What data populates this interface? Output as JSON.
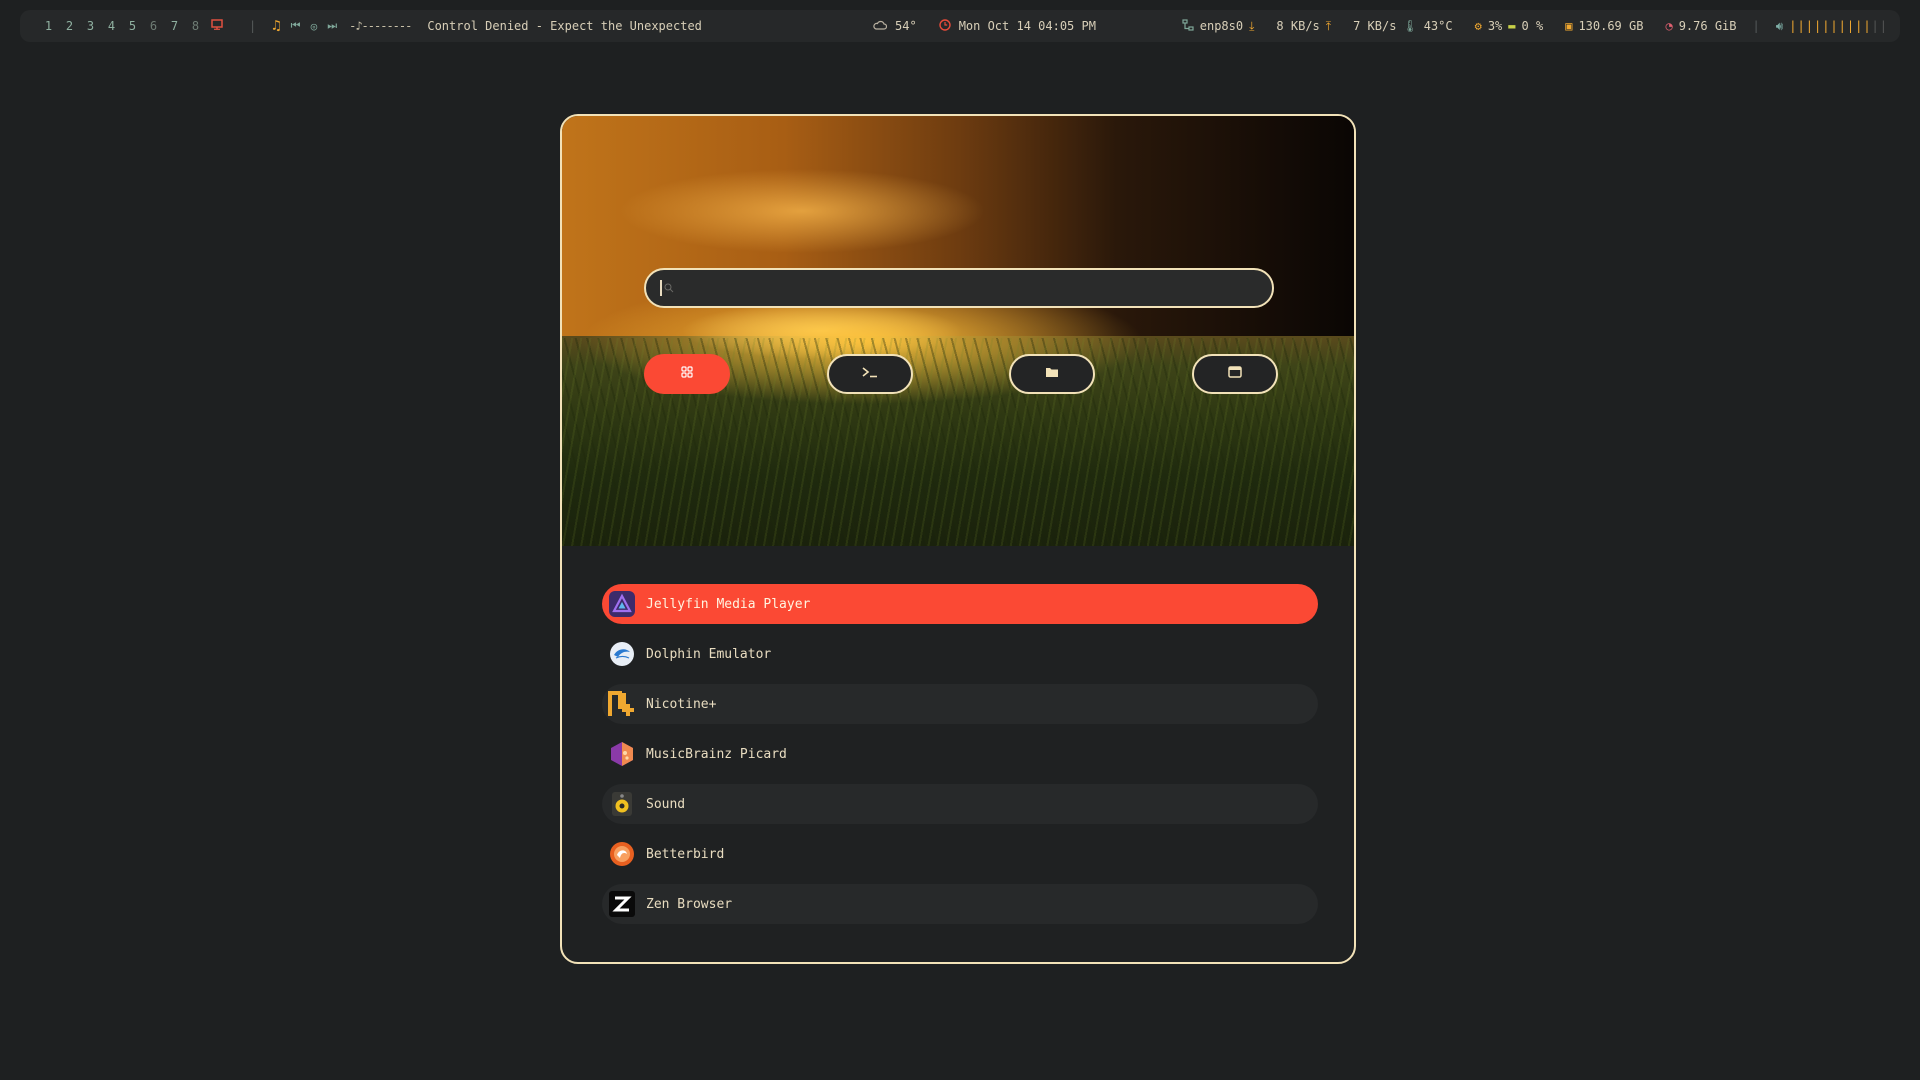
{
  "bar": {
    "workspaces": [
      "1",
      "2",
      "3",
      "4",
      "5",
      "6",
      "7",
      "8"
    ],
    "media": {
      "progress": "-♪--------",
      "song": "Control Denied - Expect the Unexpected"
    },
    "weather": "54°",
    "datetime": "Mon Oct 14 04:05 PM",
    "net_iface": "enp8s0",
    "download": "8 KB/s",
    "upload": "7 KB/s",
    "temp": "43°C",
    "cpu": "3%",
    "battery": "0 %",
    "disk": "130.69 GB",
    "mem": "9.76 GiB",
    "volume_bars": "||||||||||",
    "volume_off": "||"
  },
  "launcher": {
    "search": {
      "value": "",
      "placeholder": ""
    },
    "modes": [
      {
        "icon": "grid-icon",
        "active": true
      },
      {
        "icon": "terminal-icon",
        "active": false
      },
      {
        "icon": "folder-icon",
        "active": false
      },
      {
        "icon": "window-icon",
        "active": false
      }
    ],
    "apps": [
      {
        "name": "Jellyfin Media Player",
        "icon": "jellyfin-icon"
      },
      {
        "name": "Dolphin Emulator",
        "icon": "dolphin-icon"
      },
      {
        "name": "Nicotine+",
        "icon": "nicotine-icon"
      },
      {
        "name": "MusicBrainz Picard",
        "icon": "picard-icon"
      },
      {
        "name": "Sound",
        "icon": "speaker-icon"
      },
      {
        "name": "Betterbird",
        "icon": "betterbird-icon"
      },
      {
        "name": "Zen Browser",
        "icon": "zen-icon"
      }
    ]
  },
  "colors": {
    "accent": "#fb4934",
    "border": "#f2e2b8",
    "background": "#1e2021"
  }
}
